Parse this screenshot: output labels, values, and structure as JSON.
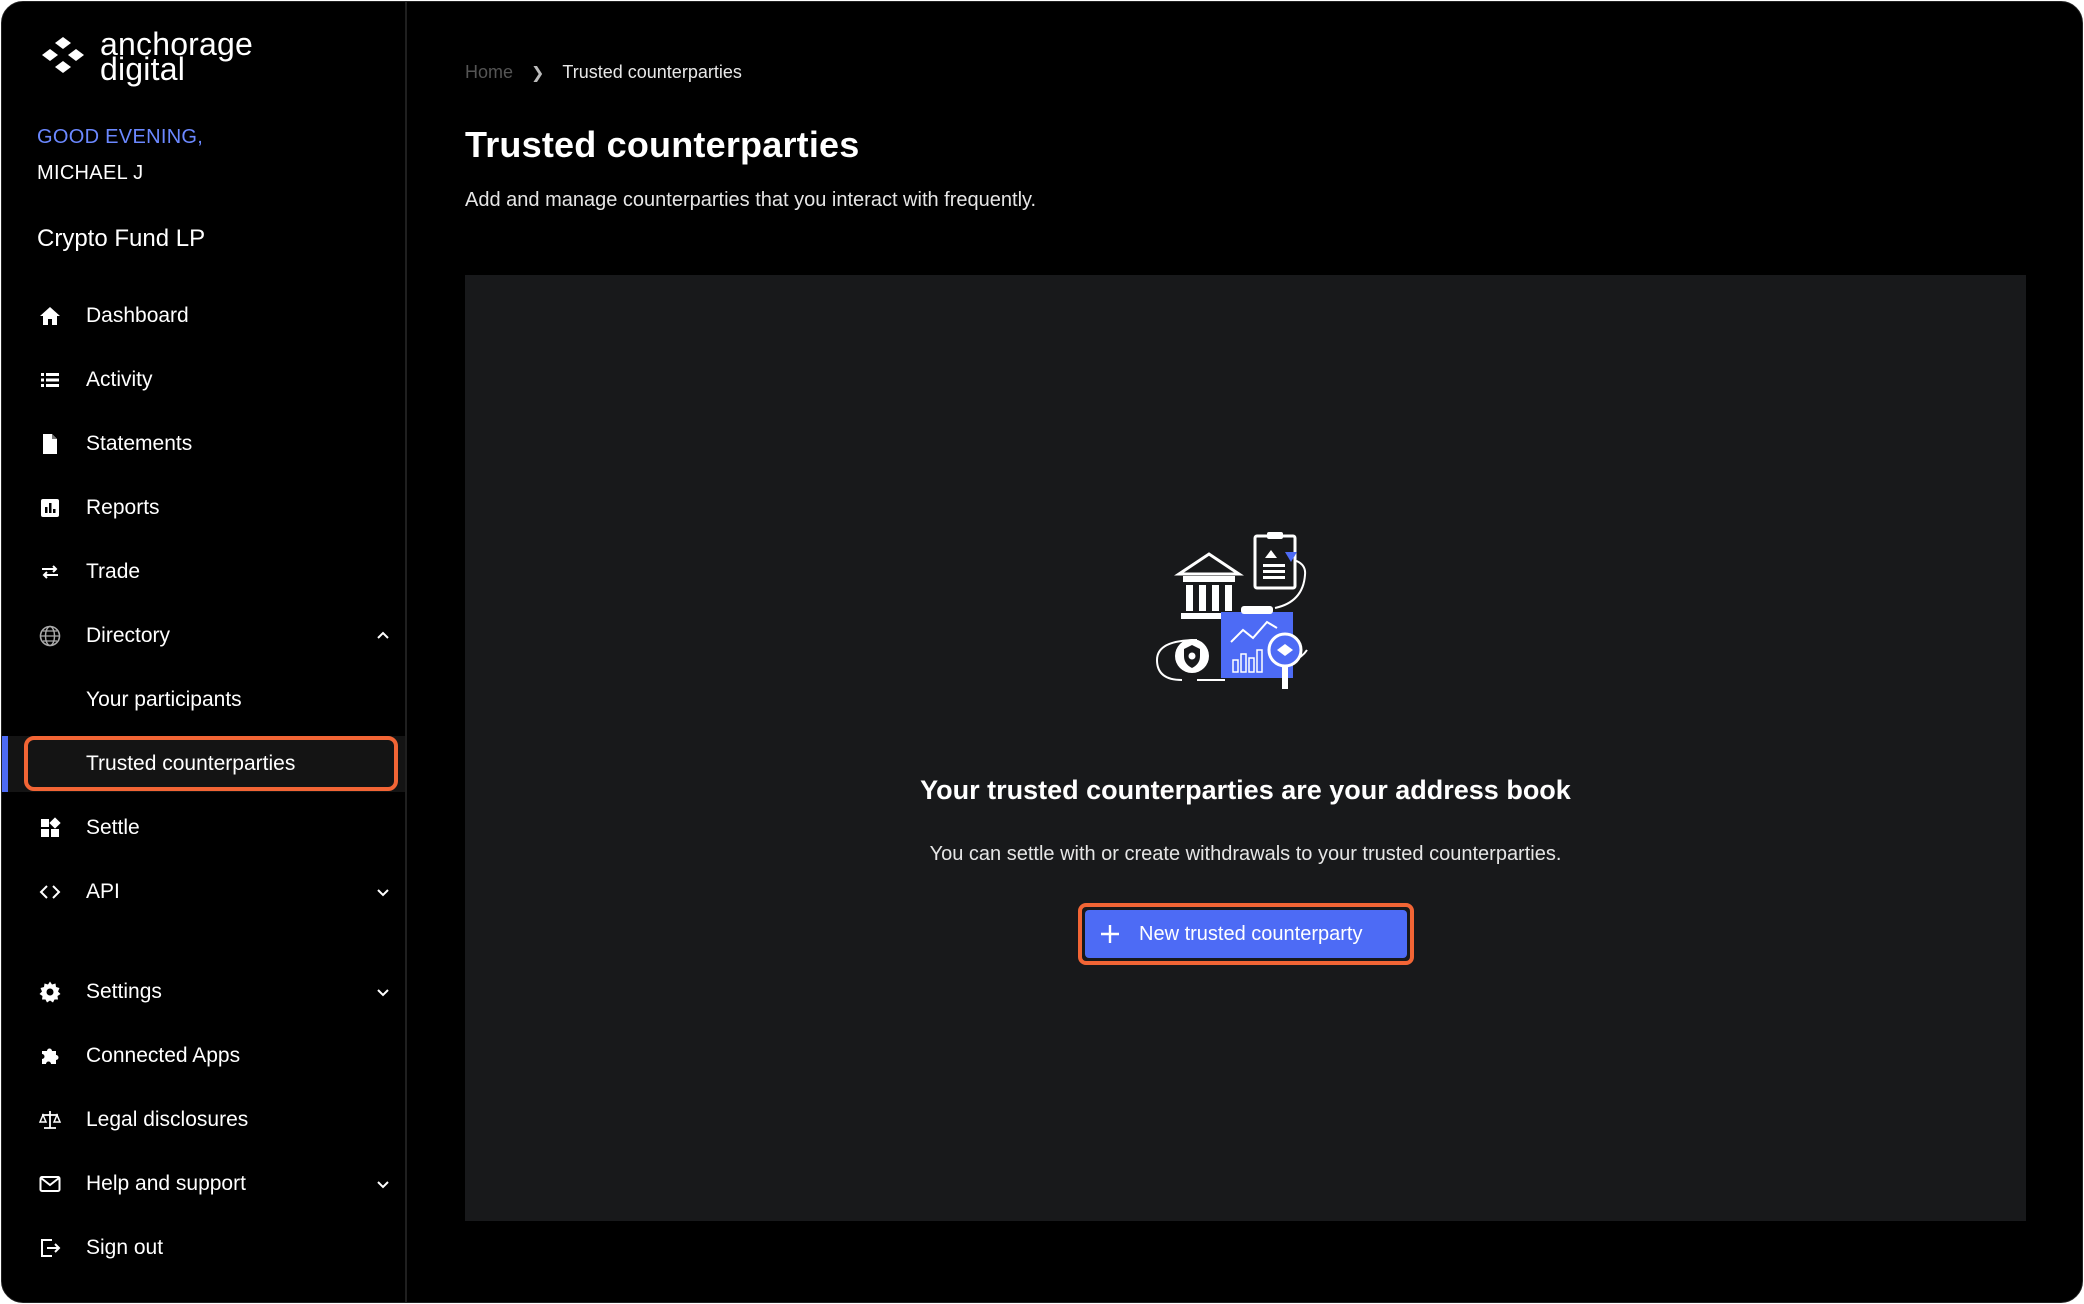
{
  "brand": {
    "line1": "anchorage",
    "line2": "digital"
  },
  "greeting": "GOOD EVENING,",
  "user": "MICHAEL J",
  "org": "Crypto Fund LP",
  "nav": {
    "dashboard": "Dashboard",
    "activity": "Activity",
    "statements": "Statements",
    "reports": "Reports",
    "trade": "Trade",
    "directory": "Directory",
    "your_participants": "Your participants",
    "trusted_counterparties": "Trusted counterparties",
    "settle": "Settle",
    "api": "API",
    "settings": "Settings",
    "connected_apps": "Connected Apps",
    "legal": "Legal disclosures",
    "help": "Help and support",
    "signout": "Sign out"
  },
  "breadcrumb": {
    "home": "Home",
    "current": "Trusted counterparties"
  },
  "page": {
    "title": "Trusted counterparties",
    "subtitle": "Add and manage counterparties that you interact with frequently."
  },
  "empty_state": {
    "title": "Your trusted counterparties are your address book",
    "subtitle": "You can settle with or create withdrawals to your trusted counterparties.",
    "button": "New trusted counterparty"
  },
  "colors": {
    "accent": "#4d6bf5",
    "highlight": "#f26535",
    "greeting": "#6b88ff",
    "panel": "#18191b"
  }
}
